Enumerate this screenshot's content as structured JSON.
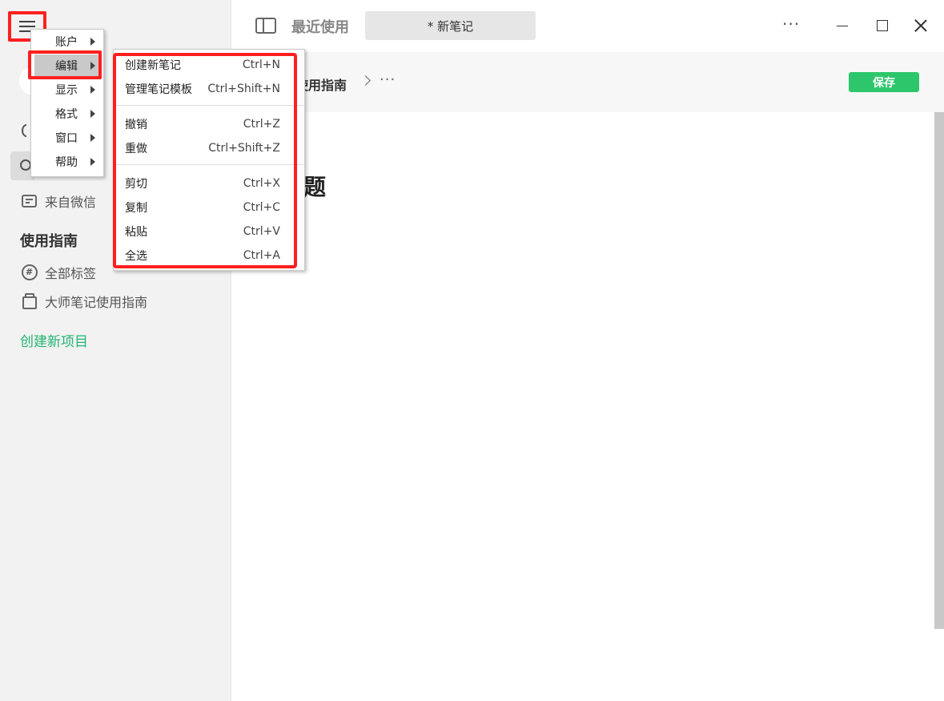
{
  "sidebar": {
    "items": [
      {
        "label": "来自微信",
        "icon": "chat-bubble-icon"
      },
      {
        "label": "全部标签",
        "icon": "hash-tag-icon"
      },
      {
        "label": "大师笔记使用指南",
        "icon": "notebook-stack-icon"
      }
    ],
    "section_title": "使用指南",
    "create_project": "创建新项目"
  },
  "topbar": {
    "recent_label": "最近使用",
    "tab_label": "* 新笔记",
    "more": "···"
  },
  "header": {
    "breadcrumb": "使用指南",
    "more": "···",
    "save_label": "保存"
  },
  "editor": {
    "title_fragment": "题"
  },
  "main_menu": {
    "items": [
      {
        "label": "账户"
      },
      {
        "label": "编辑"
      },
      {
        "label": "显示"
      },
      {
        "label": "格式"
      },
      {
        "label": "窗口"
      },
      {
        "label": "帮助"
      }
    ]
  },
  "edit_menu": {
    "items": [
      {
        "label": "创建新笔记",
        "shortcut": "Ctrl+N"
      },
      {
        "label": "管理笔记模板",
        "shortcut": "Ctrl+Shift+N"
      },
      {
        "label": "撤销",
        "shortcut": "Ctrl+Z"
      },
      {
        "label": "重做",
        "shortcut": "Ctrl+Shift+Z"
      },
      {
        "label": "剪切",
        "shortcut": "Ctrl+X"
      },
      {
        "label": "复制",
        "shortcut": "Ctrl+C"
      },
      {
        "label": "粘贴",
        "shortcut": "Ctrl+V"
      },
      {
        "label": "全选",
        "shortcut": "Ctrl+A"
      }
    ]
  },
  "colors": {
    "accent_green": "#22b573",
    "save_button": "#2ec66b",
    "highlight_red": "#ff1f1f"
  }
}
